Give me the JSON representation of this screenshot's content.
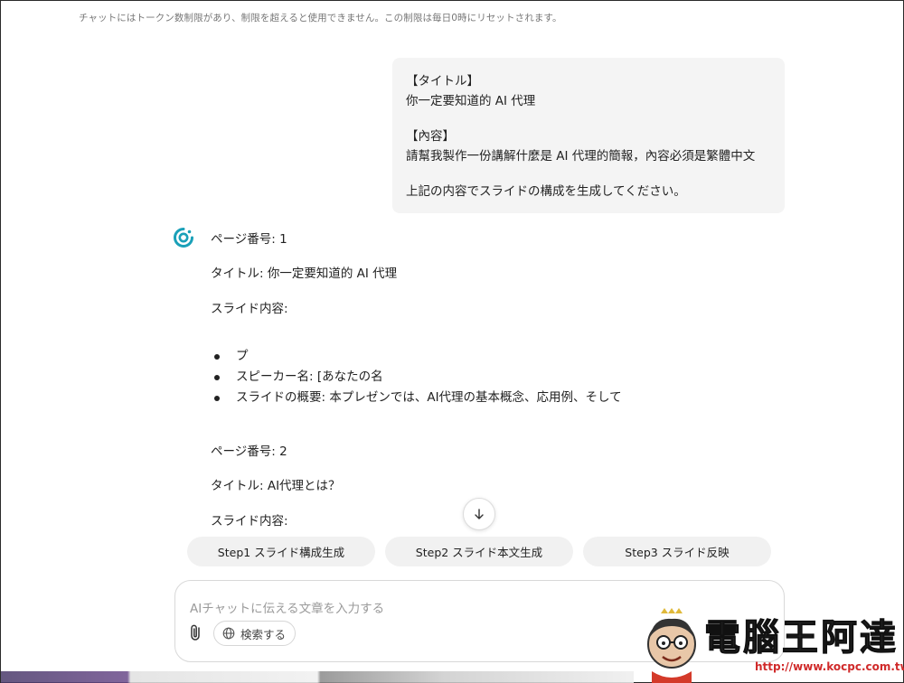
{
  "notice": "チャットにはトークン数制限があり、制限を超えると使用できません。この制限は毎日0時にリセットされます。",
  "user_message": {
    "lines": [
      "【タイトル】",
      "你一定要知道的 AI 代理",
      "",
      "【內容】",
      "請幫我製作一份講解什麼是 AI 代理的簡報，內容必須是繁體中文",
      "",
      "上記の内容でスライドの構成を生成してください。"
    ]
  },
  "assistant_message": {
    "page1_label": "ページ番号: 1",
    "page1_title": "タイトル: 你一定要知道的 AI 代理",
    "page1_content_label": "スライド内容:",
    "bullets": [
      "プ",
      "スピーカー名: [あなたの名",
      "スライドの概要: 本プレゼンでは、AI代理の基本概念、応用例、そして"
    ],
    "page2_label": "ページ番号: 2",
    "page2_title": "タイトル: AI代理とは？",
    "page2_content_label": "スライド内容:"
  },
  "steps": [
    "Step1 スライド構成生成",
    "Step2 スライド本文生成",
    "Step3 スライド反映"
  ],
  "composer": {
    "placeholder": "AIチャットに伝える文章を入力する",
    "search_label": "検索する"
  },
  "icons": {
    "assistant": "assistant-logo-icon",
    "scroll": "arrow-down-icon",
    "attach": "paperclip-icon",
    "search": "globe-icon"
  },
  "colors": {
    "accent": "#1aa0b8",
    "bubble": "#f4f4f4",
    "step_bg": "#f1f1f1"
  },
  "watermark": {
    "brand": "電腦王阿達",
    "url": "http://www.kocpc.com.tw"
  }
}
